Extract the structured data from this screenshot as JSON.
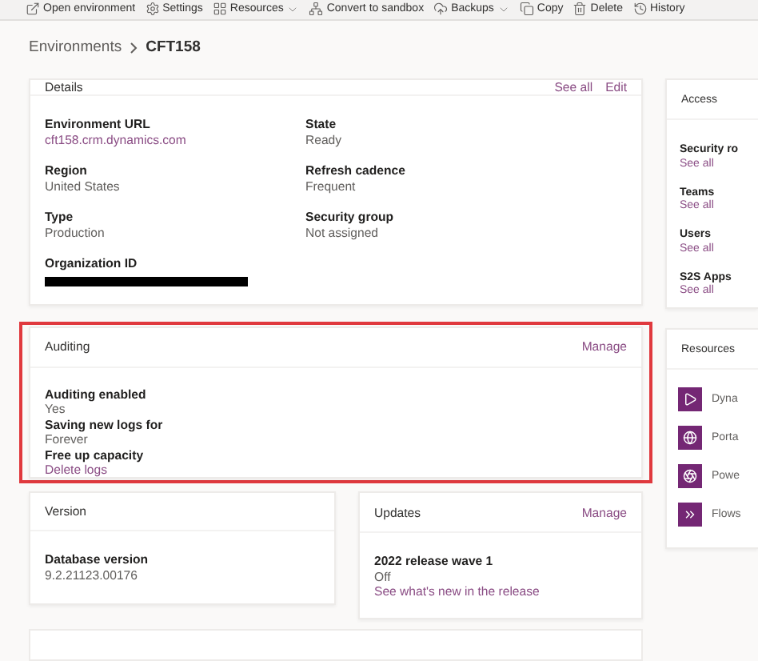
{
  "toolbar": [
    {
      "label": "Open environment",
      "kind": "button"
    },
    {
      "label": "Settings",
      "kind": "button"
    },
    {
      "label": "Resources",
      "kind": "menu"
    },
    {
      "label": "Convert to sandbox",
      "kind": "button"
    },
    {
      "label": "Backups",
      "kind": "menu"
    },
    {
      "label": "Copy",
      "kind": "button"
    },
    {
      "label": "Delete",
      "kind": "button"
    },
    {
      "label": "History",
      "kind": "button"
    }
  ],
  "breadcrumb": {
    "parent": "Environments",
    "current": "CFT158"
  },
  "details": {
    "title": "Details",
    "actions": [
      "See all",
      "Edit"
    ],
    "fields": [
      {
        "label": "Environment URL",
        "value": "cft158.crm.dynamics.com",
        "kind": "link"
      },
      {
        "label": "State",
        "value": "Ready",
        "kind": "text"
      },
      {
        "label": "Region",
        "value": "United States",
        "kind": "text"
      },
      {
        "label": "Refresh cadence",
        "value": "Frequent",
        "kind": "text"
      },
      {
        "label": "Type",
        "value": "Production",
        "kind": "text"
      },
      {
        "label": "Security group",
        "value": "Not assigned",
        "kind": "text"
      },
      {
        "label": "Organization ID",
        "kind": "redacted"
      }
    ]
  },
  "auditing": {
    "title": "Auditing",
    "action": "Manage",
    "fields": [
      {
        "label": "Auditing enabled",
        "value": "Yes",
        "kind": "text"
      },
      {
        "label": "Saving new logs for",
        "value": "Forever",
        "kind": "text"
      },
      {
        "label": "Free up capacity",
        "value": "Delete logs",
        "kind": "link"
      }
    ]
  },
  "version": {
    "title": "Version",
    "fields": [
      {
        "label": "Database version",
        "value": "9.2.21123.00176",
        "kind": "text"
      }
    ]
  },
  "updates": {
    "title": "Updates",
    "action": "Manage",
    "fields": [
      {
        "label": "2022 release wave 1",
        "value": "Off",
        "kind": "text"
      }
    ],
    "link": "See what's new in the release"
  },
  "access": {
    "title": "Access",
    "items": [
      {
        "label": "Security ro",
        "link": "See all"
      },
      {
        "label": "Teams",
        "link": "See all"
      },
      {
        "label": "Users",
        "link": "See all"
      },
      {
        "label": "S2S Apps",
        "link": "See all"
      }
    ]
  },
  "resources": {
    "title": "Resources",
    "items": [
      {
        "label": "Dyna"
      },
      {
        "label": "Porta"
      },
      {
        "label": "Powe"
      },
      {
        "label": "Flows"
      }
    ]
  }
}
